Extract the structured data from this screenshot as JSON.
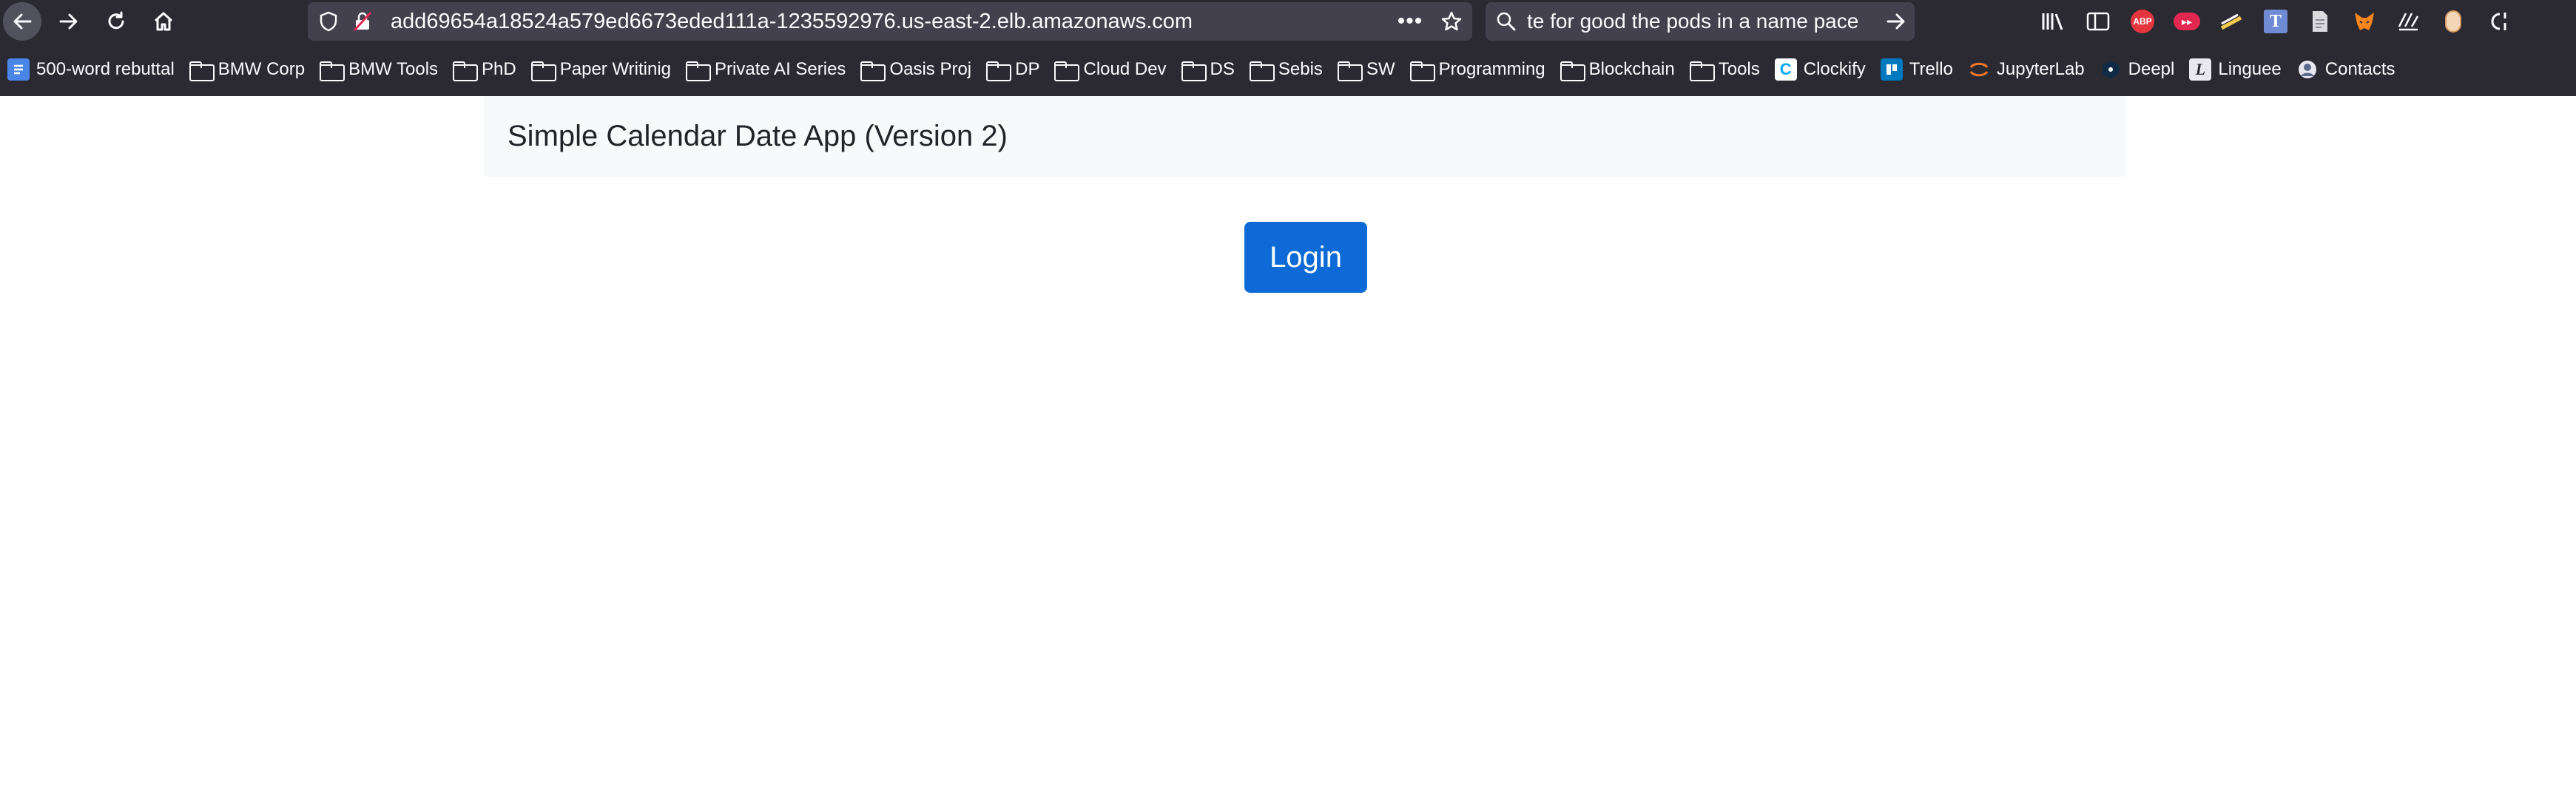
{
  "browser": {
    "url": "add69654a18524a579ed6673eded111a-1235592976.us-east-2.elb.amazonaws.com",
    "search_text": "te for good the pods in a name pace",
    "bookmarks": [
      {
        "label": "500-word rebuttal",
        "icon": "doc-icon"
      },
      {
        "label": "BMW Corp",
        "icon": "folder-icon"
      },
      {
        "label": "BMW Tools",
        "icon": "folder-icon"
      },
      {
        "label": "PhD",
        "icon": "folder-icon"
      },
      {
        "label": "Paper Writinig",
        "icon": "folder-icon"
      },
      {
        "label": "Private AI Series",
        "icon": "folder-icon"
      },
      {
        "label": "Oasis Proj",
        "icon": "folder-icon"
      },
      {
        "label": "DP",
        "icon": "folder-icon"
      },
      {
        "label": "Cloud Dev",
        "icon": "folder-icon"
      },
      {
        "label": "DS",
        "icon": "folder-icon"
      },
      {
        "label": "Sebis",
        "icon": "folder-icon"
      },
      {
        "label": "SW",
        "icon": "folder-icon"
      },
      {
        "label": "Programming",
        "icon": "folder-icon"
      },
      {
        "label": "Blockchain",
        "icon": "folder-icon"
      },
      {
        "label": "Tools",
        "icon": "folder-icon"
      },
      {
        "label": "Clockify",
        "icon": "clockify-icon"
      },
      {
        "label": "Trello",
        "icon": "trello-icon"
      },
      {
        "label": "JupyterLab",
        "icon": "jupyter-icon"
      },
      {
        "label": "Deepl",
        "icon": "deepl-icon"
      },
      {
        "label": "Linguee",
        "icon": "linguee-icon"
      },
      {
        "label": "Contacts",
        "icon": "contacts-icon"
      }
    ],
    "extensions": {
      "abp_label": "ABP"
    }
  },
  "page": {
    "brand": "Simple Calendar Date App (Version 2)",
    "login_label": "Login"
  },
  "colors": {
    "chrome_bg": "#2b2a33",
    "field_bg": "#42414d",
    "navbar_bg": "#f8f9fa",
    "primary": "#0d6ad6"
  }
}
